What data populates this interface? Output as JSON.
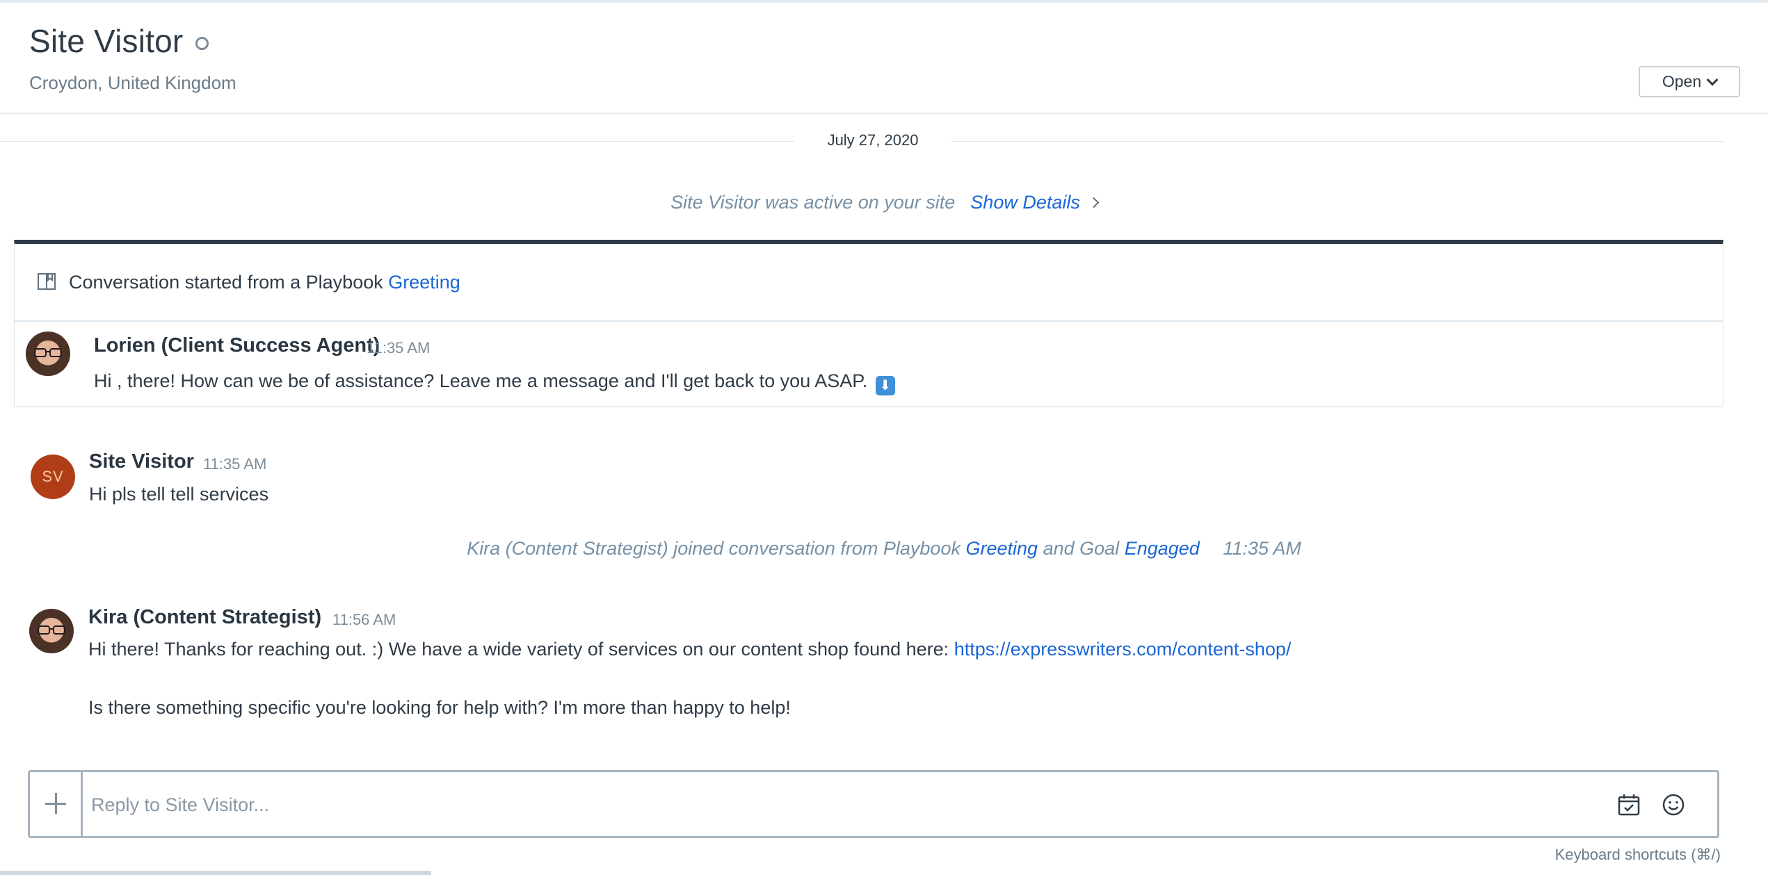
{
  "header": {
    "title": "Site Visitor",
    "location": "Croydon, United Kingdom",
    "status_button": "Open"
  },
  "conversation": {
    "date": "July 27, 2020",
    "activity_text": "Site Visitor was active on your site",
    "show_details": "Show Details",
    "playbook": {
      "prefix": "Conversation started from a Playbook",
      "link": "Greeting"
    },
    "messages": [
      {
        "author": "Lorien (Client Success Agent)",
        "time": "11:35 AM",
        "text": "Hi , there! How can we be of assistance? Leave me a message and I'll get back to you ASAP.",
        "emoji": "⬇"
      },
      {
        "author": "Site Visitor",
        "initials": "SV",
        "time": "11:35 AM",
        "text": "Hi pls tell tell services"
      },
      {
        "author": "Kira (Content Strategist)",
        "time": "11:56 AM",
        "text_before_link": "Hi there! Thanks for reaching out. :) We have a wide variety of services on our content shop found here:",
        "link": "https://expresswriters.com/content-shop/",
        "text_line2": "Is there something specific you're looking for help with? I'm more than happy to help!"
      }
    ],
    "join_note": {
      "prefix": "Kira (Content Strategist) joined conversation from Playbook",
      "playbook_link": "Greeting",
      "middle": "and Goal",
      "goal_link": "Engaged",
      "time": "11:35 AM"
    }
  },
  "composer": {
    "placeholder": "Reply to Site Visitor...",
    "keyboard_shortcuts": "Keyboard shortcuts (⌘/)"
  },
  "icons": {
    "status": "status-circle-icon",
    "playbook": "book-icon",
    "plus": "plus-icon",
    "calendar": "calendar-check-icon",
    "emoji": "smiley-icon"
  },
  "colors": {
    "link": "#1a66d6",
    "visitor_avatar": "#b13d17",
    "muted_italic": "#7590a6"
  }
}
